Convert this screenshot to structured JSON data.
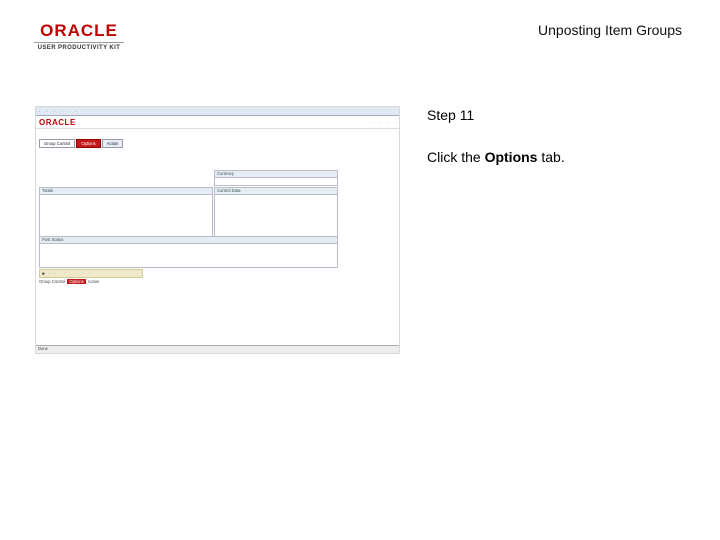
{
  "slide": {
    "title": "Unposting Item Groups",
    "step": "Step 11",
    "instruction_prefix": "Click the ",
    "instruction_target": "Options",
    "instruction_suffix": " tab."
  },
  "logo": {
    "brand": "ORACLE",
    "product": "USER PRODUCTIVITY KIT"
  },
  "screenshot": {
    "header_logo": "ORACLE",
    "tabs": [
      "Group Control",
      "Options",
      "Action"
    ],
    "active_tab_index": 1,
    "totals_header": "Totals",
    "currency_header": "Currency",
    "control_data_header": "Control Data",
    "posting_status_header": "Post Status",
    "status_bar_left": "Done",
    "bottom_tabs": [
      "Group Control",
      "Options",
      "Action"
    ],
    "colors": {
      "active_tab": "#c21a1a",
      "brand": "#c00000"
    }
  }
}
